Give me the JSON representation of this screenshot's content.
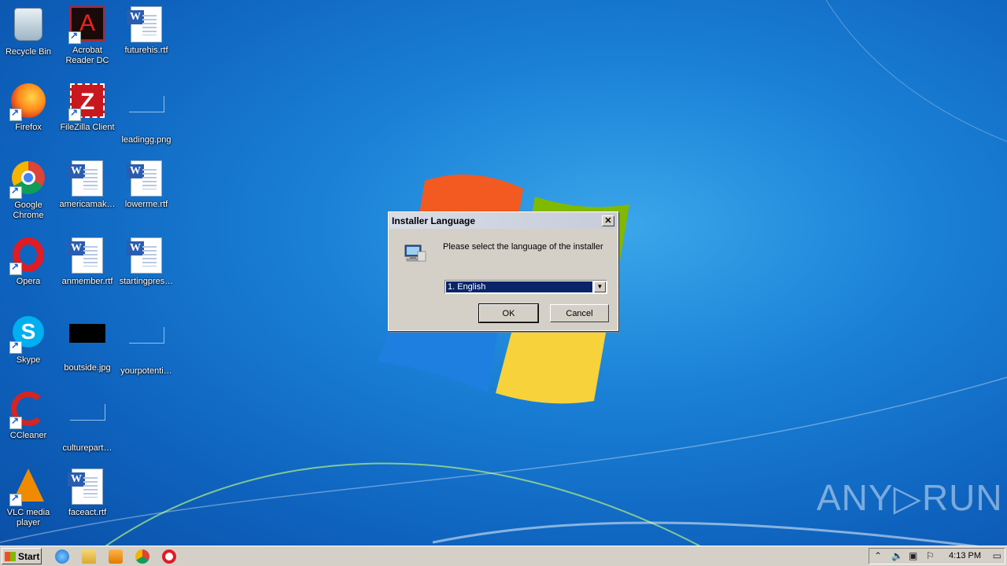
{
  "desktop": {
    "icons": [
      {
        "label": "Recycle Bin",
        "icon": "recycle-bin-icon"
      },
      {
        "label": "Acrobat Reader DC",
        "icon": "acrobat-icon"
      },
      {
        "label": "futurehis.rtf",
        "icon": "word-doc-icon"
      },
      {
        "label": "Firefox",
        "icon": "firefox-icon"
      },
      {
        "label": "FileZilla Client",
        "icon": "filezilla-icon"
      },
      {
        "label": "leadingg.png",
        "icon": "image-icon"
      },
      {
        "label": "Google Chrome",
        "icon": "chrome-icon"
      },
      {
        "label": "americamak…",
        "icon": "word-doc-icon"
      },
      {
        "label": "lowerme.rtf",
        "icon": "word-doc-icon"
      },
      {
        "label": "Opera",
        "icon": "opera-icon"
      },
      {
        "label": "anmember.rtf",
        "icon": "word-doc-icon"
      },
      {
        "label": "startingpres…",
        "icon": "word-doc-icon"
      },
      {
        "label": "Skype",
        "icon": "skype-icon"
      },
      {
        "label": "boutside.jpg",
        "icon": "image-icon"
      },
      {
        "label": "yourpotenti…",
        "icon": "image-icon"
      },
      {
        "label": "CCleaner",
        "icon": "ccleaner-icon"
      },
      {
        "label": "culturepart…",
        "icon": "image-icon"
      },
      {
        "label": "VLC media player",
        "icon": "vlc-icon"
      },
      {
        "label": "faceact.rtf",
        "icon": "word-doc-icon"
      }
    ]
  },
  "dialog": {
    "title": "Installer Language",
    "close_label": "✕",
    "message": "Please select the language of the installer",
    "language_selected": "1. English",
    "ok_label": "OK",
    "cancel_label": "Cancel"
  },
  "taskbar": {
    "start_label": "Start",
    "quick_launch": [
      "internet-explorer-icon",
      "explorer-icon",
      "media-player-icon",
      "chrome-icon",
      "opera-icon"
    ],
    "clock": "4:13 PM"
  },
  "watermark": "ANY▷RUN"
}
